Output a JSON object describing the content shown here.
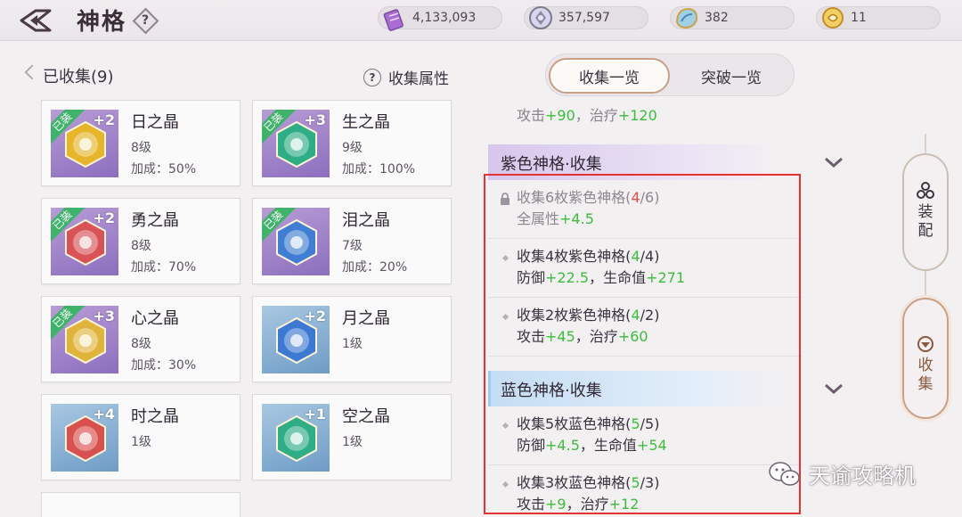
{
  "header": {
    "title": "神格",
    "help_label": "?",
    "currencies": [
      {
        "name": "purple-crystal",
        "value": "4,133,093"
      },
      {
        "name": "silver-coin",
        "value": "357,597"
      },
      {
        "name": "blue-shell",
        "value": "382"
      },
      {
        "name": "gold-scroll",
        "value": "11"
      }
    ]
  },
  "collection": {
    "heading": "已收集(9)",
    "attr_help": "?",
    "attr_label": "收集属性",
    "cards": [
      {
        "name": "日之晶",
        "level": "8级",
        "bonus": "加成：50%",
        "plus": "+2",
        "equipped": "已装",
        "frame": "purple",
        "gem_color": "#e6b52a"
      },
      {
        "name": "生之晶",
        "level": "9级",
        "bonus": "加成：100%",
        "plus": "+3",
        "equipped": "已装",
        "frame": "purple",
        "gem_color": "#2fae86"
      },
      {
        "name": "勇之晶",
        "level": "8级",
        "bonus": "加成：70%",
        "plus": "+2",
        "equipped": "已装",
        "frame": "purple",
        "gem_color": "#d95356"
      },
      {
        "name": "泪之晶",
        "level": "7级",
        "bonus": "加成：20%",
        "plus": "",
        "equipped": "已装",
        "frame": "purple",
        "gem_color": "#3f7ed3"
      },
      {
        "name": "心之晶",
        "level": "8级",
        "bonus": "加成：30%",
        "plus": "+3",
        "equipped": "已装",
        "frame": "purple",
        "gem_color": "#e0b43a"
      },
      {
        "name": "月之晶",
        "level": "1级",
        "bonus": "",
        "plus": "+2",
        "equipped": "",
        "frame": "blue",
        "gem_color": "#3b79d2"
      },
      {
        "name": "时之晶",
        "level": "1级",
        "bonus": "",
        "plus": "+4",
        "equipped": "",
        "frame": "blue",
        "gem_color": "#d9514f"
      },
      {
        "name": "空之晶",
        "level": "1级",
        "bonus": "",
        "plus": "+1",
        "equipped": "",
        "frame": "blue",
        "gem_color": "#2fae86"
      }
    ]
  },
  "tabs": {
    "active": "收集一览",
    "inactive": "突破一览"
  },
  "list": {
    "prev": {
      "a": "攻击",
      "av": "+90",
      "sep": "，",
      "b": "治疗",
      "bv": "+120"
    },
    "purple_group": "紫色神格·收集",
    "purple_entries": [
      {
        "prefix": "收集6枚紫色神格(",
        "have": "4",
        "need": "/6)",
        "have_red": true,
        "a": "全属性",
        "av": "+4.5",
        "b": "",
        "bv": "",
        "locked": true
      },
      {
        "prefix": "收集4枚紫色神格(",
        "have": "4",
        "need": "/4)",
        "have_red": false,
        "a": "防御",
        "av": "+22.5",
        "b": "生命值",
        "bv": "+271",
        "locked": false
      },
      {
        "prefix": "收集2枚紫色神格(",
        "have": "4",
        "need": "/2)",
        "have_red": false,
        "a": "攻击",
        "av": "+45",
        "b": "治疗",
        "bv": "+60",
        "locked": false
      }
    ],
    "blue_group": "蓝色神格·收集",
    "blue_entries": [
      {
        "prefix": "收集5枚蓝色神格(",
        "have": "5",
        "need": "/5)",
        "have_red": false,
        "a": "防御",
        "av": "+4.5",
        "b": "生命值",
        "bv": "+54",
        "locked": false
      },
      {
        "prefix": "收集3枚蓝色神格(",
        "have": "5",
        "need": "/3)",
        "have_red": false,
        "a": "攻击",
        "av": "+9",
        "b": "治疗",
        "bv": "+12",
        "locked": false
      }
    ],
    "comma": "，"
  },
  "side": {
    "equip_label": [
      "装",
      "配"
    ],
    "collect_label": [
      "收",
      "集"
    ]
  },
  "watermark": "天谕攻略机"
}
